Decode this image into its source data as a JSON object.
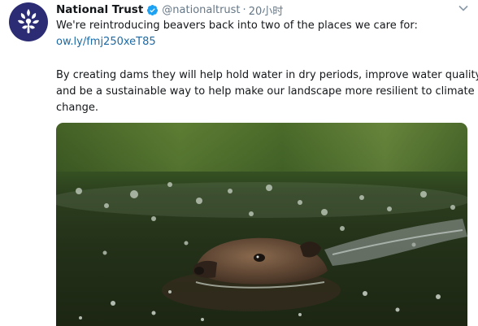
{
  "tweet": {
    "author_name": "National Trust",
    "handle": "@nationaltrust",
    "separator": "·",
    "time": "20小时",
    "text_line1": "We're reintroducing beavers back into two of the places we care for:",
    "link": "ow.ly/fmj250xeT85",
    "para2_line1": "By creating dams they will help hold water in dry periods, improve water quality",
    "para2_line2": "and be a sustainable way to help make our landscape more resilient to climate",
    "para2_line3": "change."
  },
  "colors": {
    "avatar_bg": "#2b2c74",
    "verified": "#1da1f2",
    "link": "#1b6aa5",
    "secondary_text": "#657786"
  },
  "icons": {
    "avatar_logo": "oak-leaf-logo",
    "verified": "verified-badge-icon",
    "menu": "chevron-down-icon"
  }
}
